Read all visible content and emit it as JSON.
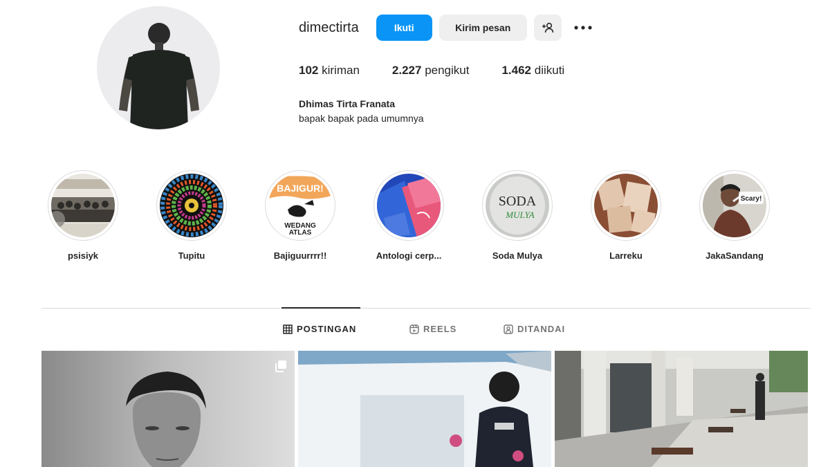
{
  "profile": {
    "username": "dimectirta",
    "follow_label": "Ikuti",
    "message_label": "Kirim pesan",
    "suggest_icon": "add-person-icon",
    "more_icon": "more-horizontal-icon",
    "stats": [
      {
        "count": "102",
        "label": "kiriman"
      },
      {
        "count": "2.227",
        "label": "pengikut"
      },
      {
        "count": "1.462",
        "label": "diikuti"
      }
    ],
    "full_name": "Dhimas Tirta Franata",
    "bio": "bapak bapak pada umumnya"
  },
  "highlights": [
    {
      "label": "psisiyk"
    },
    {
      "label": "Tupitu"
    },
    {
      "label": "Bajiguurrrr!!",
      "cover_text_top": "BAJIGUR!",
      "cover_text_bottom_1": "WEDANG",
      "cover_text_bottom_2": "ATLAS"
    },
    {
      "label": "Antologi cerp..."
    },
    {
      "label": "Soda Mulya",
      "cover_text_1": "SODA",
      "cover_text_2": "MULYA"
    },
    {
      "label": "Larreku"
    },
    {
      "label": "JakaSandang",
      "cover_text": "Scary!"
    }
  ],
  "tabs": [
    {
      "label": "POSTINGAN",
      "icon": "grid-icon",
      "active": true
    },
    {
      "label": "REELS",
      "icon": "reels-icon",
      "active": false
    },
    {
      "label": "DITANDAI",
      "icon": "tagged-icon",
      "active": false
    }
  ],
  "posts": [
    {
      "kind": "carousel",
      "icon": "multiple-posts-icon"
    },
    {
      "kind": "photo"
    },
    {
      "kind": "photo"
    }
  ],
  "colors": {
    "accent": "#0a95f6",
    "secondary_button": "#efefef",
    "divider": "#dbdbdb"
  }
}
